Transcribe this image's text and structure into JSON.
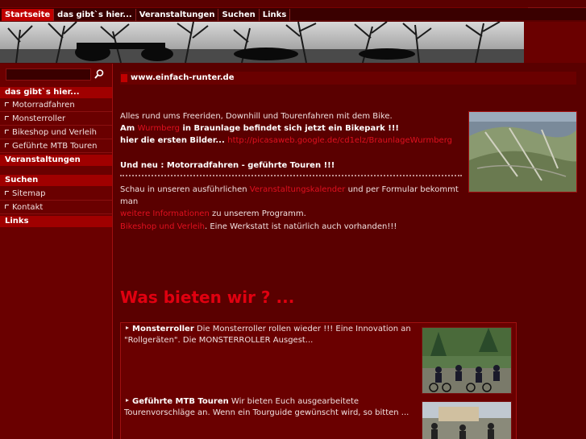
{
  "topnav": {
    "items": [
      "Startseite",
      "das gibt`s hier...",
      "Veranstaltungen",
      "Suchen",
      "Links"
    ]
  },
  "sidebar": {
    "search_value": "",
    "section1": "das gibt`s hier...",
    "items1": [
      "Motorradfahren",
      "Monsterroller",
      "Bikeshop und Verleih",
      "Geführte MTB Touren"
    ],
    "section2": "Veranstaltungen",
    "section3": "Suchen",
    "items3": [
      "Sitemap",
      "Kontakt"
    ],
    "section4": "Links"
  },
  "content": {
    "url_title": "www.einfach-runter.de",
    "intro": "Alles rund ums Freeriden, Downhill und Tourenfahren mit dem Bike.",
    "am_prefix": "Am ",
    "wurmberg": "Wurmberg",
    "am_suffix": " in Braunlage befindet sich jetzt ein Bikepark !!!",
    "bilder_prefix": "hier die ersten Bilder... ",
    "picasa_link": "http://picasaweb.google.de/cd1elz/BraunlageWurmberg",
    "neu": "Und neu : Motorradfahren - geführte Touren !!!",
    "schau_prefix": "Schau in unseren ausführlichen ",
    "kalender_link": "Veranstaltungskalender",
    "schau_suffix": " und per Formular bekommt man",
    "weitere_link": "weitere Informationen",
    "weitere_suffix": " zu unserem Programm.",
    "bikeshop_link": "Bikeshop und Verleih",
    "bikeshop_suffix": ". Eine Werkstatt ist natürlich auch vorhanden!!!",
    "heading": "Was bieten wir ? ...",
    "offers": [
      {
        "title": "Monsterroller",
        "text": " Die Monsterroller rollen wieder !!! Eine Innovation an \"Rollgeräten\". Die MONSTERROLLER Ausgest..."
      },
      {
        "title": "Geführte MTB Touren",
        "text": " Wir bieten Euch ausgearbeitete Tourenvorschläge an. Wenn ein Tourguide gewünscht wird, so bitten ..."
      }
    ]
  },
  "colors": {
    "bg": "#5a0000",
    "accent": "#c00000",
    "link": "#e0101f"
  }
}
